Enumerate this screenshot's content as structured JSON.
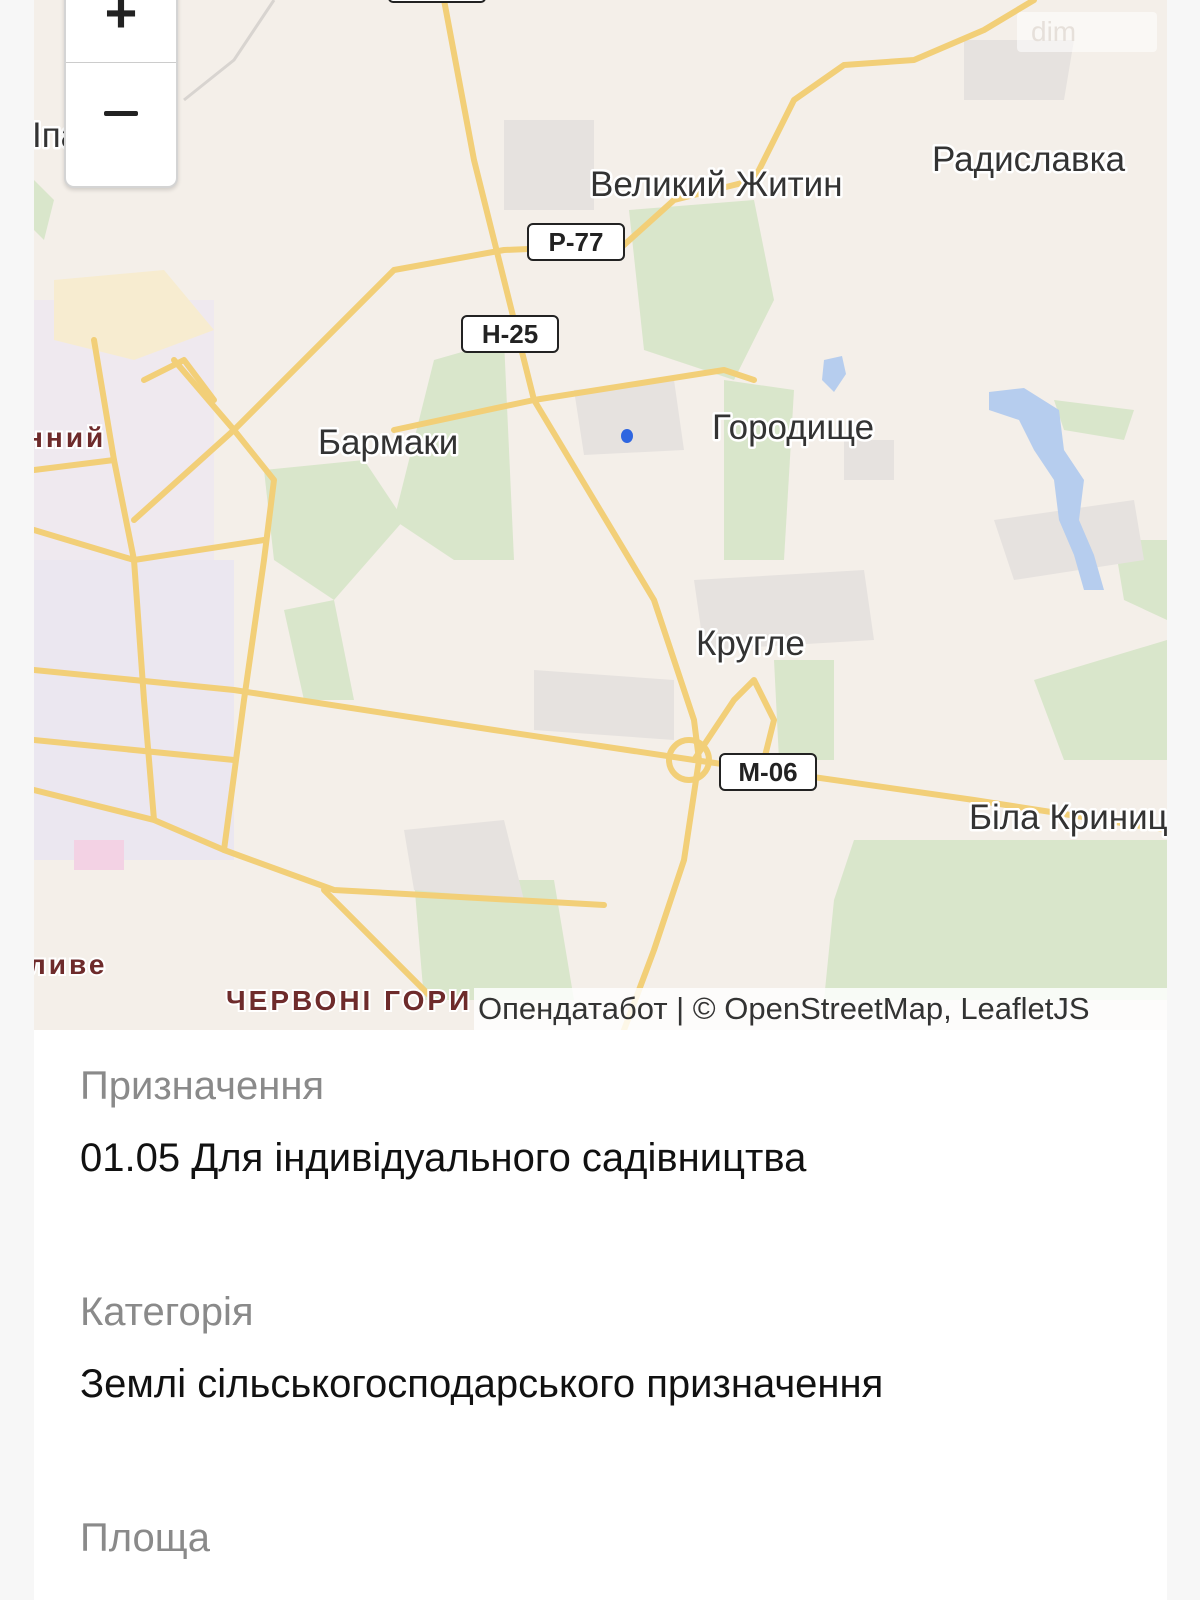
{
  "map": {
    "places": {
      "velykyi_zhytyn": "Великий Житин",
      "radyslavka": "Радиславка",
      "barmaky": "Бармаки",
      "horodyshche": "Городище",
      "kruhle": "Кругле",
      "bila_krynytsia": "Біла Криниц",
      "chervoni_hory": "ЧЕРВОНІ ГОРИ",
      "left_partial_1": "Іпа",
      "left_partial_2": "нний",
      "left_partial_3": "ливе"
    },
    "road_shields": {
      "r77": "Р-77",
      "n25": "Н-25",
      "m06": "М-06"
    },
    "watermark": "dim",
    "attribution": "Опендатабот | © OpenStreetMap, LeafletJS",
    "colors": {
      "background": "#f4efe9",
      "road": "#f2cf78",
      "forest": "#d7e5c8",
      "water": "#a9c6ec",
      "marker": "#2f66e0"
    }
  },
  "details": {
    "purpose_label": "Призначення",
    "purpose_value": "01.05 Для індивідуального садівництва",
    "category_label": "Категорія",
    "category_value": "Землі сільськогосподарського призначення",
    "area_label": "Площа"
  }
}
